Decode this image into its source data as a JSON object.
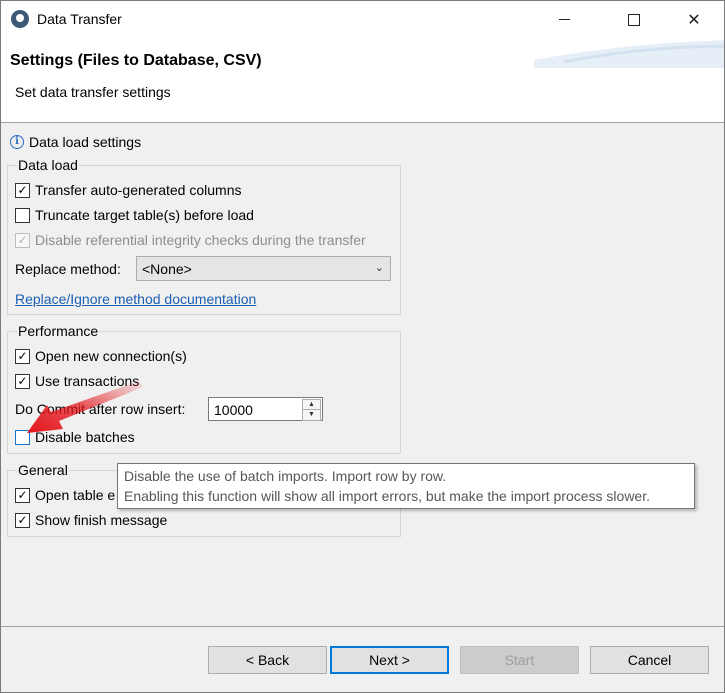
{
  "window": {
    "title": "Data Transfer"
  },
  "header": {
    "title": "Settings (Files to Database, CSV)",
    "subtitle": "Set data transfer settings"
  },
  "info": {
    "label": "Data load settings"
  },
  "data_load": {
    "legend": "Data load",
    "transfer_auto": {
      "label": "Transfer auto-generated columns",
      "checked": true
    },
    "truncate": {
      "label": "Truncate target table(s) before load",
      "checked": false
    },
    "disable_ref": {
      "label": "Disable referential integrity checks during the transfer",
      "checked": true,
      "enabled": false
    },
    "replace_method": {
      "label": "Replace method:",
      "value": "<None>"
    },
    "doc_link": "Replace/Ignore method documentation"
  },
  "performance": {
    "legend": "Performance",
    "open_conn": {
      "label": "Open new connection(s)",
      "checked": true
    },
    "use_tx": {
      "label": "Use transactions",
      "checked": true
    },
    "commit": {
      "label": "Do Commit after row insert:",
      "value": "10000"
    },
    "disable_batches": {
      "label": "Disable batches",
      "checked": false
    }
  },
  "general": {
    "legend": "General",
    "open_table": {
      "label": "Open table e",
      "checked": true
    },
    "show_finish": {
      "label": "Show finish message",
      "checked": true
    }
  },
  "tooltip": {
    "line1": "Disable the use of batch imports. Import row by row.",
    "line2": "Enabling this function will show all import errors, but make the import process slower."
  },
  "buttons": {
    "back": "< Back",
    "next": "Next >",
    "start": "Start",
    "cancel": "Cancel"
  },
  "icons": {
    "app": "app-logo-icon",
    "info": "info-icon",
    "minimize": "minimize-icon",
    "maximize": "maximize-icon",
    "close": "close-icon",
    "dropdown": "chevron-down-icon",
    "arrow": "red-arrow-annotation"
  },
  "colors": {
    "link": "#1a5fb4",
    "default_button_border": "#0078d7",
    "arrow": "#e3141b"
  }
}
